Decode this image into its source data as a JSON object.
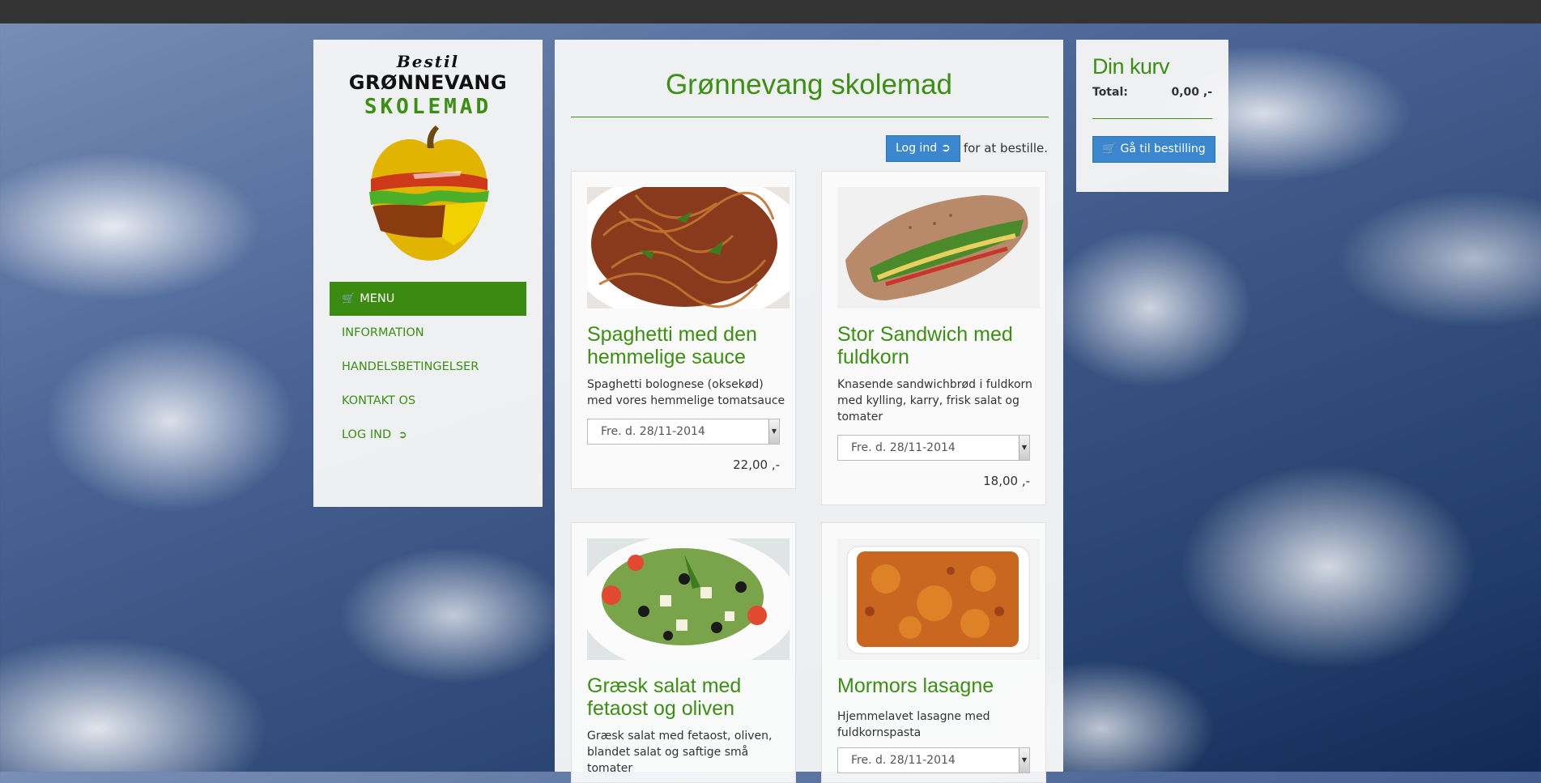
{
  "sidebar": {
    "logo": {
      "line1": "Bestil",
      "line2": "GRØNNEVANG",
      "line3": "SKOLEMAD"
    },
    "nav": [
      {
        "label": "MENU",
        "icon": "cart-icon",
        "active": true
      },
      {
        "label": "INFORMATION"
      },
      {
        "label": "HANDELSBETINGELSER"
      },
      {
        "label": "KONTAKT OS"
      },
      {
        "label": "LOG IND",
        "icon": "sign-in-icon"
      }
    ]
  },
  "main": {
    "title": "Grønnevang skolemad",
    "login_button": "Log ind",
    "login_note": "for at bestille.",
    "products": [
      {
        "title": "Spaghetti med den hemmelige sauce",
        "description": "Spaghetti bolognese (oksekød) med vores hemmelige tomatsauce",
        "date": "Fre. d. 28/11-2014",
        "price": "22,00 ,-"
      },
      {
        "title": "Stor Sandwich med fuldkorn",
        "description": "Knasende sandwichbrød i fuldkorn med kylling, karry, frisk salat og tomater",
        "date": "Fre. d. 28/11-2014",
        "price": "18,00 ,-"
      },
      {
        "title": "Græsk salat med fetaost og oliven",
        "description": "Græsk salat med fetaost, oliven, blandet salat og saftige små tomater",
        "date": "",
        "price": ""
      },
      {
        "title": "Mormors lasagne",
        "description": "Hjemmelavet lasagne med fuldkornspasta",
        "date": "Fre. d. 28/11-2014",
        "price": ""
      }
    ]
  },
  "basket": {
    "title": "Din kurv",
    "total_label": "Total:",
    "total_value": "0,00 ,-",
    "button": "Gå til bestilling"
  },
  "colors": {
    "accent": "#3b8f12",
    "button": "#3a87cf",
    "topbar": "#333333"
  }
}
